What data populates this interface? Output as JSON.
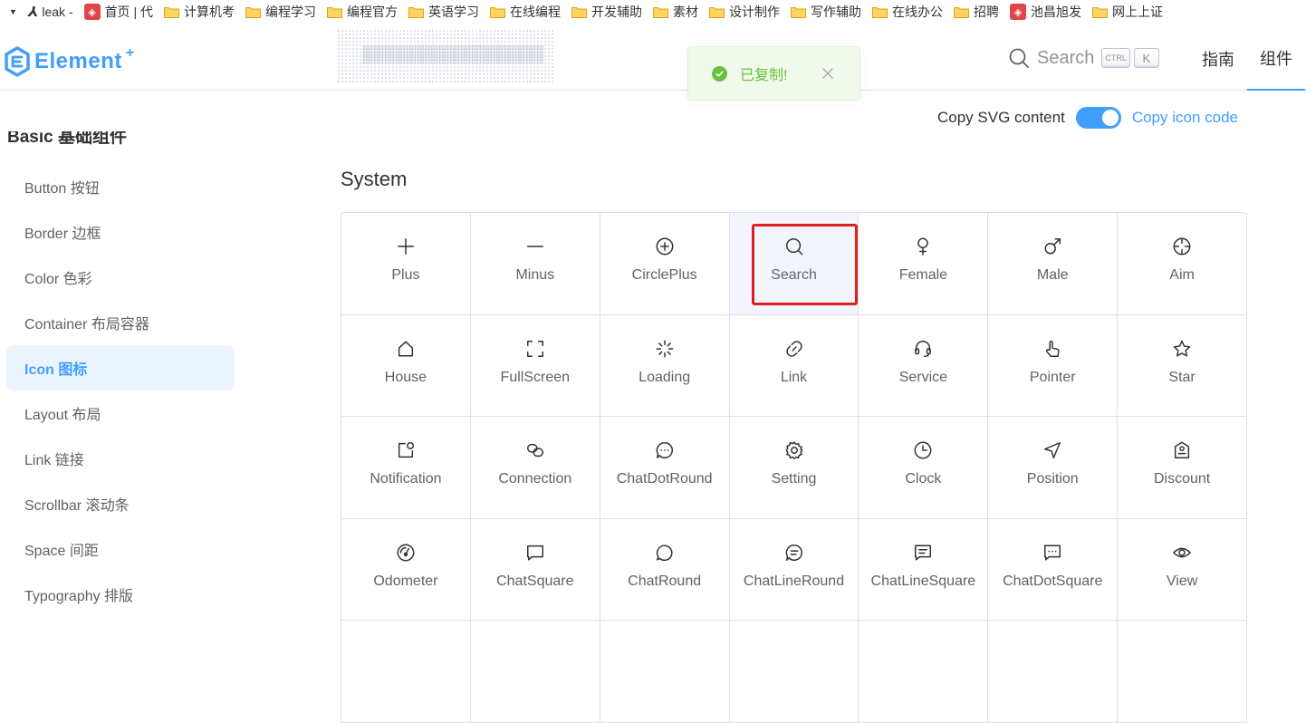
{
  "bookmarks": {
    "first": "leak -",
    "items": [
      {
        "label": "首页 | 代",
        "icon": "red-app-icon"
      },
      {
        "label": "计算机考",
        "icon": "folder-icon"
      },
      {
        "label": "编程学习",
        "icon": "folder-icon"
      },
      {
        "label": "编程官方",
        "icon": "folder-icon"
      },
      {
        "label": "英语学习",
        "icon": "folder-icon"
      },
      {
        "label": "在线编程",
        "icon": "folder-icon"
      },
      {
        "label": "开发辅助",
        "icon": "folder-icon"
      },
      {
        "label": "素材",
        "icon": "folder-icon"
      },
      {
        "label": "设计制作",
        "icon": "folder-icon"
      },
      {
        "label": "写作辅助",
        "icon": "folder-icon"
      },
      {
        "label": "在线办公",
        "icon": "folder-icon"
      },
      {
        "label": "招聘",
        "icon": "folder-icon"
      },
      {
        "label": "池昌旭发",
        "icon": "red-app-icon"
      },
      {
        "label": "网上上证",
        "icon": "folder-icon"
      }
    ]
  },
  "header": {
    "logo_text": "Element",
    "logo_sup": "+",
    "search_label": "Search",
    "kbd_ctrl": "CTRL",
    "kbd_k": "K",
    "nav": [
      {
        "label": "指南",
        "active": false
      },
      {
        "label": "组件",
        "active": true
      }
    ]
  },
  "toast": {
    "text": "已复制!",
    "color": "#67c23a"
  },
  "sidebar": {
    "group_title": "Basic 基础组件",
    "items": [
      {
        "label": "Button 按钮",
        "active": false
      },
      {
        "label": "Border 边框",
        "active": false
      },
      {
        "label": "Color 色彩",
        "active": false
      },
      {
        "label": "Container 布局容器",
        "active": false
      },
      {
        "label": "Icon 图标",
        "active": true
      },
      {
        "label": "Layout 布局",
        "active": false
      },
      {
        "label": "Link 链接",
        "active": false
      },
      {
        "label": "Scrollbar 滚动条",
        "active": false
      },
      {
        "label": "Space 间距",
        "active": false
      },
      {
        "label": "Typography 排版",
        "active": false
      }
    ]
  },
  "toolbar": {
    "copy_svg_label": "Copy SVG content",
    "switch_on": true,
    "copy_code_label": "Copy icon code"
  },
  "section": {
    "title": "System"
  },
  "icons": [
    {
      "name": "Plus",
      "icon": "plus-icon"
    },
    {
      "name": "Minus",
      "icon": "minus-icon"
    },
    {
      "name": "CirclePlus",
      "icon": "circle-plus-icon"
    },
    {
      "name": "Search",
      "icon": "search-icon",
      "selected": true
    },
    {
      "name": "Female",
      "icon": "female-icon"
    },
    {
      "name": "Male",
      "icon": "male-icon"
    },
    {
      "name": "Aim",
      "icon": "aim-icon"
    },
    {
      "name": "House",
      "icon": "house-icon"
    },
    {
      "name": "FullScreen",
      "icon": "fullscreen-icon"
    },
    {
      "name": "Loading",
      "icon": "loading-icon"
    },
    {
      "name": "Link",
      "icon": "link-icon"
    },
    {
      "name": "Service",
      "icon": "service-icon"
    },
    {
      "name": "Pointer",
      "icon": "pointer-icon"
    },
    {
      "name": "Star",
      "icon": "star-icon"
    },
    {
      "name": "Notification",
      "icon": "notification-icon"
    },
    {
      "name": "Connection",
      "icon": "connection-icon"
    },
    {
      "name": "ChatDotRound",
      "icon": "chat-dot-round-icon"
    },
    {
      "name": "Setting",
      "icon": "setting-icon"
    },
    {
      "name": "Clock",
      "icon": "clock-icon"
    },
    {
      "name": "Position",
      "icon": "position-icon"
    },
    {
      "name": "Discount",
      "icon": "discount-icon"
    },
    {
      "name": "Odometer",
      "icon": "odometer-icon"
    },
    {
      "name": "ChatSquare",
      "icon": "chat-square-icon"
    },
    {
      "name": "ChatRound",
      "icon": "chat-round-icon"
    },
    {
      "name": "ChatLineRound",
      "icon": "chat-line-round-icon"
    },
    {
      "name": "ChatLineSquare",
      "icon": "chat-line-square-icon"
    },
    {
      "name": "ChatDotSquare",
      "icon": "chat-dot-square-icon"
    },
    {
      "name": "View",
      "icon": "view-icon"
    },
    {
      "name": "",
      "icon": ""
    },
    {
      "name": "",
      "icon": ""
    },
    {
      "name": "",
      "icon": ""
    },
    {
      "name": "",
      "icon": ""
    },
    {
      "name": "",
      "icon": ""
    },
    {
      "name": "",
      "icon": ""
    },
    {
      "name": "",
      "icon": ""
    }
  ]
}
